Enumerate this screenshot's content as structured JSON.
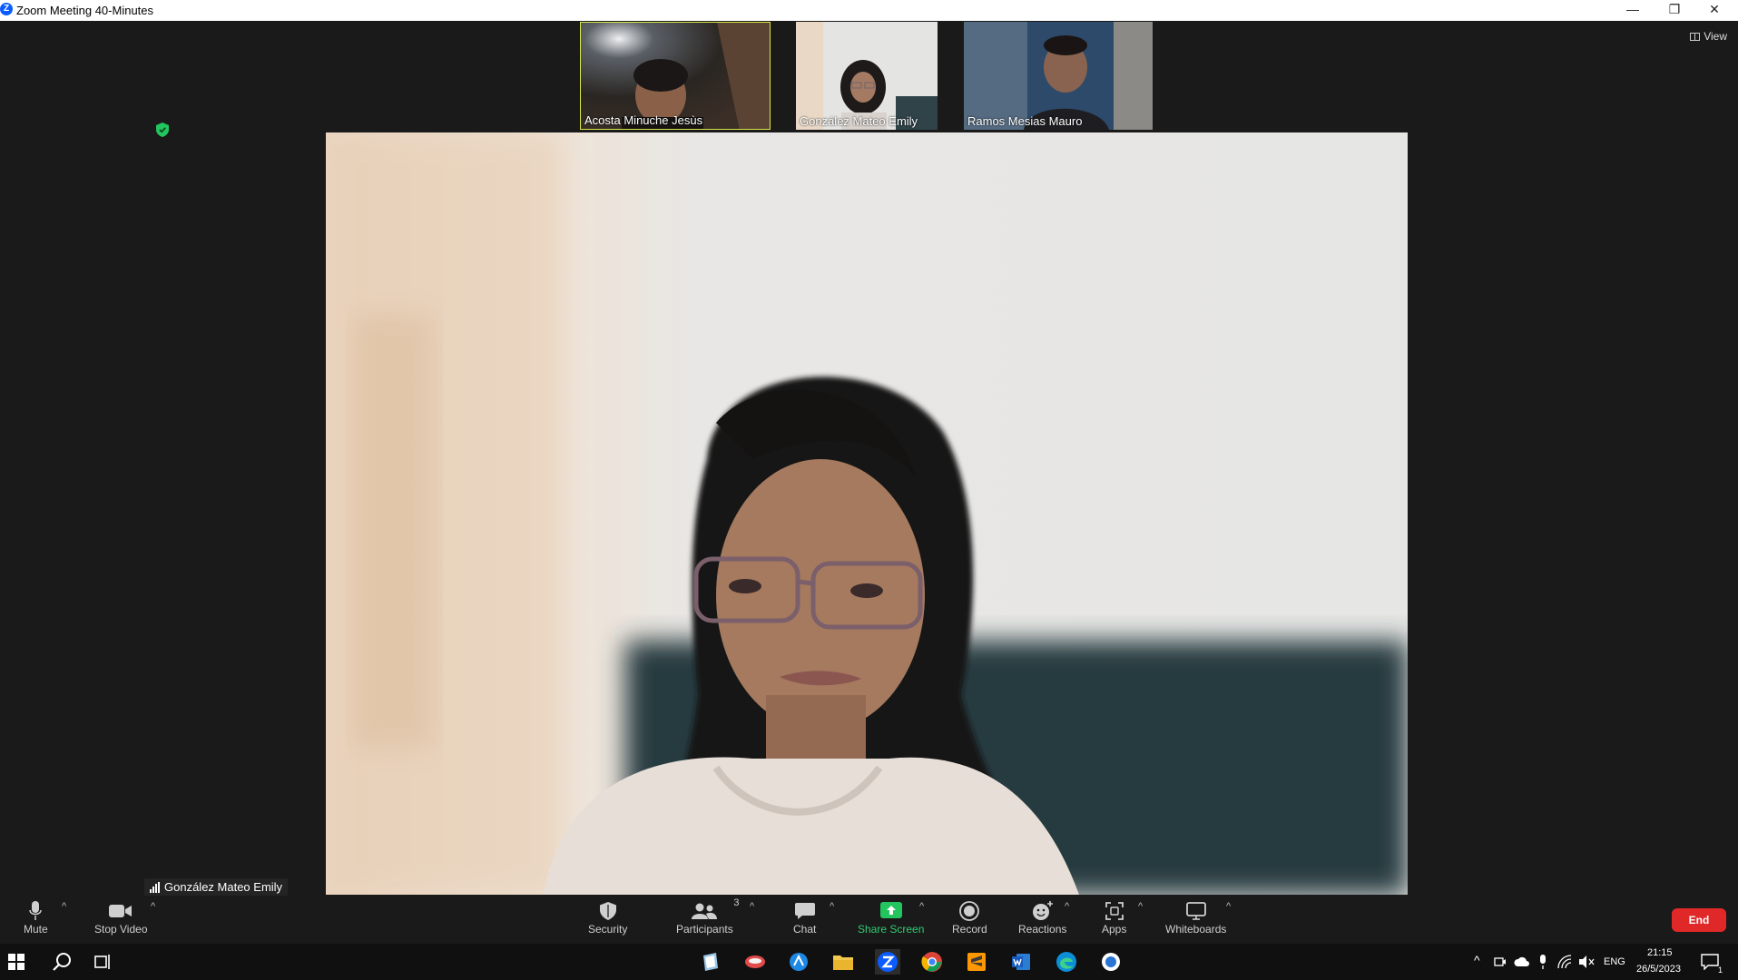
{
  "window": {
    "app_icon": "Z",
    "title": "Zoom Meeting 40-Minutes",
    "minimize_glyph": "—",
    "restore_glyph": "❐",
    "close_glyph": "✕"
  },
  "stage": {
    "view_label": "View",
    "thumbnails": [
      {
        "name": "Acosta Minuche Jesùs",
        "active": true
      },
      {
        "name": "González Mateo Emily",
        "active": false
      },
      {
        "name": "Ramos Mesias Mauro",
        "active": false
      }
    ],
    "active_speaker": "González Mateo Emily",
    "shield_color": "#22c55e"
  },
  "toolbar": {
    "mute_label": "Mute",
    "stop_video_label": "Stop Video",
    "security_label": "Security",
    "participants_label": "Participants",
    "participants_count": "3",
    "chat_label": "Chat",
    "share_screen_label": "Share Screen",
    "record_label": "Record",
    "reactions_label": "Reactions",
    "apps_label": "Apps",
    "whiteboards_label": "Whiteboards",
    "end_label": "End",
    "caret_glyph": "^",
    "share_color": "#22c55e",
    "end_color": "#e02828"
  },
  "taskbar": {
    "language": "ENG",
    "time": "21:15",
    "date": "26/5/2023",
    "notification_count": "1",
    "tray_up_glyph": "^"
  }
}
